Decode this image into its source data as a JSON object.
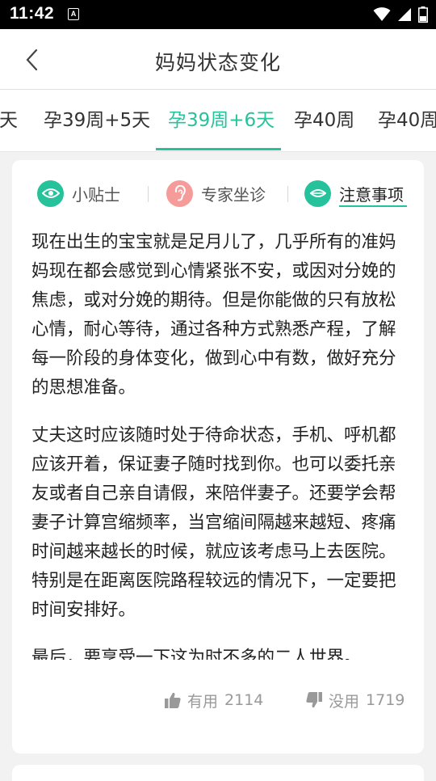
{
  "status_bar": {
    "time": "11:42",
    "notification_glyph": "A"
  },
  "header": {
    "title": "妈妈状态变化"
  },
  "week_tabs": [
    {
      "label": "天",
      "active": false
    },
    {
      "label": "孕39周+5天",
      "active": false
    },
    {
      "label": "孕39周+6天",
      "active": true
    },
    {
      "label": "孕40周",
      "active": false
    },
    {
      "label": "孕40周",
      "active": false
    }
  ],
  "content_tabs": [
    {
      "label": "小贴士",
      "icon": "eye-icon",
      "color": "#25c29b",
      "active": false
    },
    {
      "label": "专家坐诊",
      "icon": "ear-icon",
      "color": "#f59c9a",
      "active": false
    },
    {
      "label": "注意事项",
      "icon": "lips-icon",
      "color": "#25c29b",
      "active": true
    }
  ],
  "article": {
    "paragraphs": [
      "现在出生的宝宝就是足月儿了，几乎所有的准妈妈现在都会感觉到心情紧张不安，或因对分娩的焦虑，或对分娩的期待。但是你能做的只有放松心情，耐心等待，通过各种方式熟悉产程，了解每一阶段的身体变化，做到心中有数，做好充分的思想准备。",
      " 丈夫这时应该随时处于待命状态，手机、呼机都应该开着，保证妻子随时找到你。也可以委托亲友或者自己亲自请假，来陪伴妻子。还要学会帮妻子计算宫缩频率，当宫缩间隔越来越短、疼痛时间越来越长的时候，就应该考虑马上去医院。特别是在距离医院路程较远的情况下，一定要把时间安排好。",
      "最后，要享受一下这为时不多的二人世界。"
    ]
  },
  "votes": {
    "useful_label": "有用",
    "useful_count": "2114",
    "useless_label": "没用",
    "useless_count": "1719"
  },
  "colors": {
    "accent": "#25c29b",
    "ear": "#f59c9a"
  }
}
